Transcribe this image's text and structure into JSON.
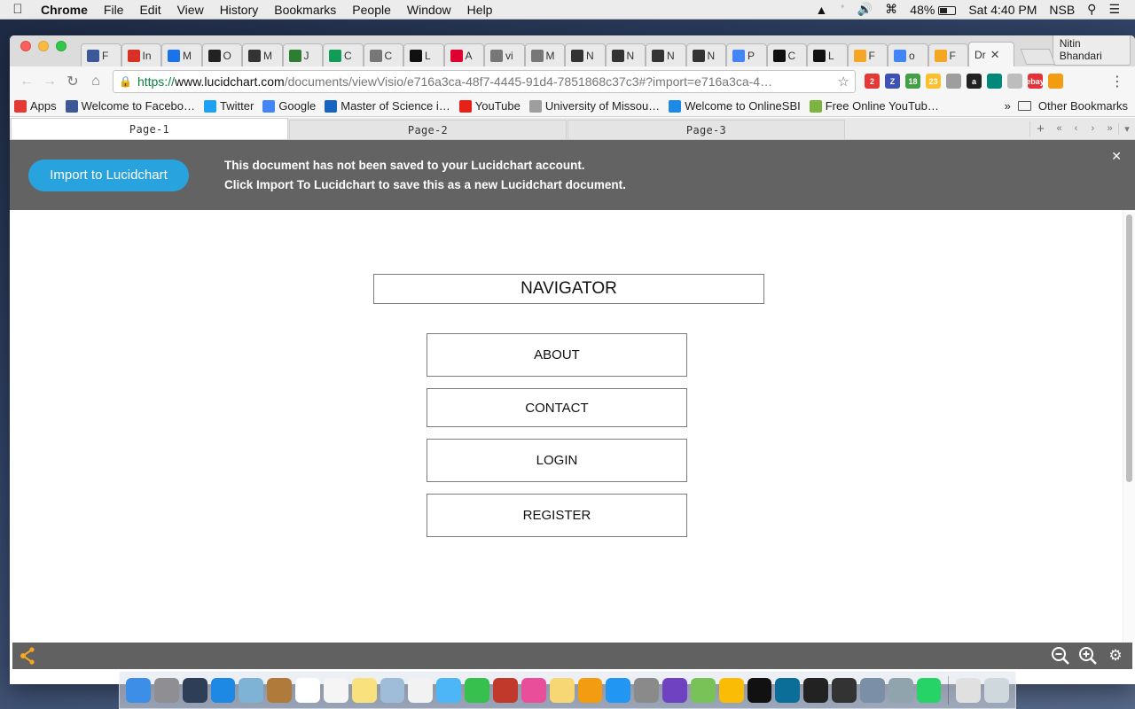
{
  "menubar": {
    "app_name": "Chrome",
    "menus": [
      "File",
      "Edit",
      "View",
      "History",
      "Bookmarks",
      "People",
      "Window",
      "Help"
    ],
    "status": {
      "battery": "48%",
      "clock": "Sat 4:40 PM",
      "user": "NSB"
    }
  },
  "browser": {
    "tabs": [
      {
        "label": "F",
        "icon": "facebook-icon",
        "color": "#3b5998"
      },
      {
        "label": "In",
        "icon": "gmail-icon",
        "color": "#d93025"
      },
      {
        "label": "M",
        "icon": "mail-icon",
        "color": "#1a73e8"
      },
      {
        "label": "O",
        "icon": "circle-a-icon",
        "color": "#222222"
      },
      {
        "label": "M",
        "icon": "webstorm-icon",
        "color": "#333333"
      },
      {
        "label": "J",
        "icon": "eye-icon",
        "color": "#2e7d32"
      },
      {
        "label": "C",
        "icon": "sheets-icon",
        "color": "#0f9d58"
      },
      {
        "label": "C",
        "icon": "doc-icon",
        "color": "#777777"
      },
      {
        "label": "L",
        "icon": "github-icon",
        "color": "#111111"
      },
      {
        "label": "A",
        "icon": "angular-icon",
        "color": "#dd0031"
      },
      {
        "label": "vi",
        "icon": "doc-icon",
        "color": "#777777"
      },
      {
        "label": "M",
        "icon": "doc-icon",
        "color": "#777777"
      },
      {
        "label": "N",
        "icon": "webstorm-icon",
        "color": "#333333"
      },
      {
        "label": "N",
        "icon": "webstorm-icon",
        "color": "#333333"
      },
      {
        "label": "N",
        "icon": "webstorm-icon",
        "color": "#333333"
      },
      {
        "label": "N",
        "icon": "webstorm-icon",
        "color": "#333333"
      },
      {
        "label": "P",
        "icon": "google-photos-icon",
        "color": "#4285f4"
      },
      {
        "label": "C",
        "icon": "github-icon",
        "color": "#111111"
      },
      {
        "label": "L",
        "icon": "github-icon",
        "color": "#111111"
      },
      {
        "label": "F",
        "icon": "lucidchart-icon",
        "color": "#f5a623"
      },
      {
        "label": "o",
        "icon": "google-icon",
        "color": "#4285f4"
      },
      {
        "label": "F",
        "icon": "lucidchart-icon",
        "color": "#f5a623"
      },
      {
        "label": "Dr",
        "icon": "none",
        "color": "#f6f6f6"
      }
    ],
    "profile_name": "Nitin Bhandari",
    "url": {
      "scheme": "https://",
      "host": "www.lucidchart.com",
      "path": "/documents/viewVisio/e716a3ca-48f7-4445-91d4-7851868c37c3#?import=e716a3ca-4…"
    },
    "extensions": [
      {
        "label": "2",
        "color": "#e53935"
      },
      {
        "label": "Z",
        "color": "#3f51b5"
      },
      {
        "label": "18",
        "color": "#43a047"
      },
      {
        "label": "23",
        "color": "#fbc02d"
      },
      {
        "label": "",
        "color": "#9e9e9e"
      },
      {
        "label": "a",
        "color": "#222222"
      },
      {
        "label": "",
        "color": "#00897b"
      },
      {
        "label": "",
        "color": "#bdbdbd"
      },
      {
        "label": "ebay",
        "color": "#e53238"
      },
      {
        "label": "",
        "color": "#f39c12"
      }
    ],
    "bookmarks": [
      {
        "label": "Apps",
        "icon": "apps-grid-icon",
        "color": "#e53935"
      },
      {
        "label": "Welcome to Facebo…",
        "icon": "facebook-icon",
        "color": "#3b5998"
      },
      {
        "label": "Twitter",
        "icon": "twitter-icon",
        "color": "#1da1f2"
      },
      {
        "label": "Google",
        "icon": "google-icon",
        "color": "#4285f4"
      },
      {
        "label": "Master of Science i…",
        "icon": "university-icon",
        "color": "#1565c0"
      },
      {
        "label": "YouTube",
        "icon": "youtube-icon",
        "color": "#e62117"
      },
      {
        "label": "University of Missou…",
        "icon": "document-icon",
        "color": "#9e9e9e"
      },
      {
        "label": "Welcome to OnlineSBI",
        "icon": "sbi-icon",
        "color": "#1e88e5"
      },
      {
        "label": "Free Online YouTub…",
        "icon": "download-arrow-icon",
        "color": "#7cb342"
      }
    ],
    "other_bookmarks": "Other Bookmarks"
  },
  "lucid": {
    "pages": [
      "Page-1",
      "Page-2",
      "Page-3"
    ],
    "banner": {
      "button": "Import to Lucidchart",
      "line1": "This document has not been saved to your Lucidchart account.",
      "line2": "Click Import To Lucidchart to save this as a new Lucidchart document."
    },
    "diagram": {
      "title": "NAVIGATOR",
      "items": [
        "ABOUT",
        "CONTACT",
        "LOGIN",
        "REGISTER"
      ]
    },
    "accent": "#29a3dd"
  },
  "dock": {
    "apps": [
      {
        "name": "finder",
        "color": "#3d8ee6"
      },
      {
        "name": "launchpad",
        "color": "#8e8e93"
      },
      {
        "name": "mission-control",
        "color": "#2f3e57"
      },
      {
        "name": "safari",
        "color": "#1e88e5"
      },
      {
        "name": "preview",
        "color": "#7fb3d5"
      },
      {
        "name": "contacts",
        "color": "#b07a3b"
      },
      {
        "name": "calendar",
        "color": "#ffffff"
      },
      {
        "name": "reminders",
        "color": "#f5f5f5"
      },
      {
        "name": "notes",
        "color": "#f9e27d"
      },
      {
        "name": "photo-booth",
        "color": "#9fbdd8"
      },
      {
        "name": "photos",
        "color": "#f2f2f2"
      },
      {
        "name": "messages",
        "color": "#4db6f7"
      },
      {
        "name": "facetime",
        "color": "#37c04d"
      },
      {
        "name": "photo-booth-2",
        "color": "#c0392b"
      },
      {
        "name": "itunes",
        "color": "#e94e9b"
      },
      {
        "name": "stickies",
        "color": "#f7d774"
      },
      {
        "name": "ibooks",
        "color": "#f39c12"
      },
      {
        "name": "app-store",
        "color": "#2196f3"
      },
      {
        "name": "system-preferences",
        "color": "#8a8a8a"
      },
      {
        "name": "github-desktop",
        "color": "#6f42c1"
      },
      {
        "name": "android-studio",
        "color": "#78c257"
      },
      {
        "name": "chrome",
        "color": "#fbbc05"
      },
      {
        "name": "intellij",
        "color": "#111111"
      },
      {
        "name": "webstorm",
        "color": "#0b6e99"
      },
      {
        "name": "terminal",
        "color": "#222222"
      },
      {
        "name": "inkscape",
        "color": "#333333"
      },
      {
        "name": "xcode-tools",
        "color": "#7b8fa6"
      },
      {
        "name": "network-utility",
        "color": "#90a4ae"
      },
      {
        "name": "whatsapp",
        "color": "#25d366"
      },
      {
        "name": "documents",
        "color": "#e0e0e0"
      },
      {
        "name": "trash",
        "color": "#cfd8dc"
      }
    ]
  }
}
